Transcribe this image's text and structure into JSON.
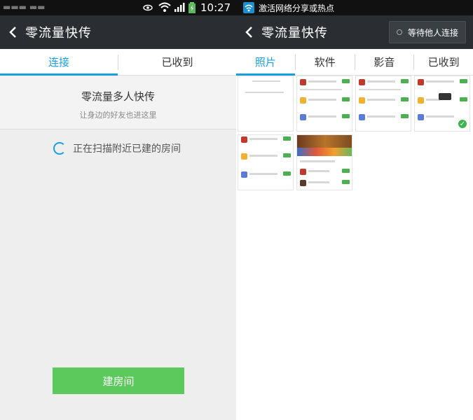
{
  "left": {
    "status": {
      "time": "10:27"
    },
    "appbar": {
      "title": "零流量快传"
    },
    "tabs": [
      {
        "label": "连接"
      },
      {
        "label": "已收到"
      }
    ],
    "card": {
      "title": "零流量多人快传",
      "subtitle": "让身边的好友也进这里"
    },
    "scan_text": "正在扫描附近已建的房间",
    "build_button": "建房间"
  },
  "right": {
    "status": {
      "notice": "激活网络分享或热点"
    },
    "appbar": {
      "title": "零流量快传",
      "wait_button": "等待他人连接"
    },
    "tabs": [
      {
        "label": "照片"
      },
      {
        "label": "软件"
      },
      {
        "label": "影音"
      },
      {
        "label": "已收到"
      }
    ]
  },
  "colors": {
    "accent": "#1aa0e0",
    "build_green": "#5cc95c",
    "appbar": "#2a2e33"
  }
}
